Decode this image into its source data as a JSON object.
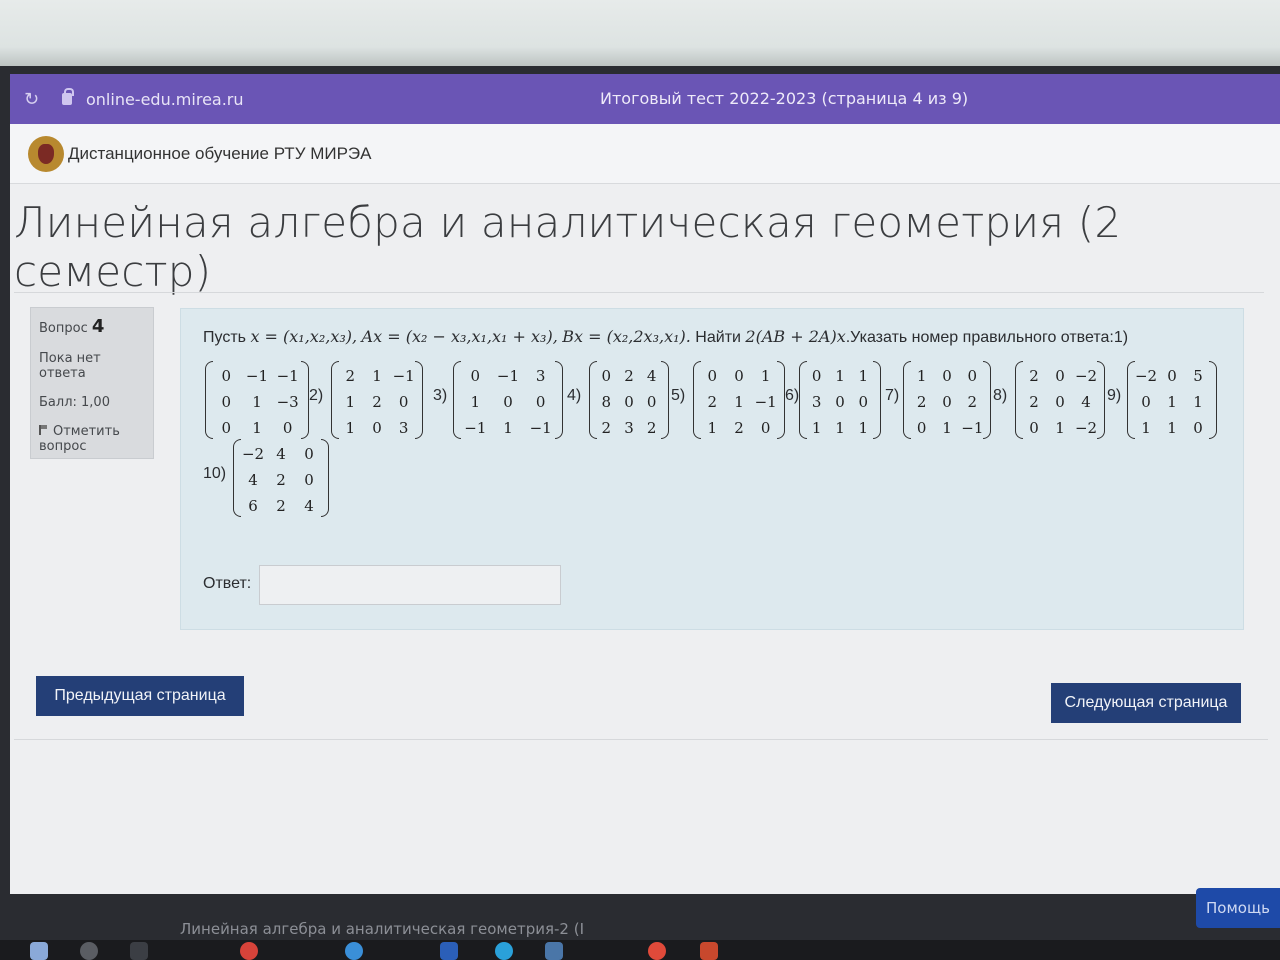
{
  "browser": {
    "url": "online-edu.mirea.ru",
    "tab_title": "Итоговый тест 2022-2023 (страница 4 из 9)"
  },
  "site": {
    "name": "Дистанционное обучение РТУ МИРЭА"
  },
  "course": {
    "title": "Линейная алгебра и аналитическая геометрия (2 семестр)"
  },
  "question_info": {
    "label": "Вопрос",
    "number": "4",
    "status": "Пока нет ответа",
    "score": "Балл: 1,00",
    "flag_label": "Отметить вопрос"
  },
  "question": {
    "intro": "Пусть",
    "x_def": "x = (x₁,x₂,x₃),",
    "a_def": "Ax = (x₂ − x₃,x₁,x₁ + x₃),",
    "b_def": "Bx = (x₂,2x₃,x₁).",
    "find": "Найти",
    "expr": "2(AB + 2A)x",
    "instruction": ".Указать номер правильного ответа:",
    "option_labels": [
      "1)",
      "2)",
      "3)",
      "4)",
      "5)",
      "6)",
      "7)",
      "8)",
      "9)",
      "10)"
    ],
    "matrices": [
      [
        [
          "0",
          "−1",
          "−1"
        ],
        [
          "0",
          "1",
          "−3"
        ],
        [
          "0",
          "1",
          "0"
        ]
      ],
      [
        [
          "2",
          "1",
          "−1"
        ],
        [
          "1",
          "2",
          "0"
        ],
        [
          "1",
          "0",
          "3"
        ]
      ],
      [
        [
          "0",
          "−1",
          "3"
        ],
        [
          "1",
          "0",
          "0"
        ],
        [
          "−1",
          "1",
          "−1"
        ]
      ],
      [
        [
          "0",
          "2",
          "4"
        ],
        [
          "8",
          "0",
          "0"
        ],
        [
          "2",
          "3",
          "2"
        ]
      ],
      [
        [
          "0",
          "0",
          "1"
        ],
        [
          "2",
          "1",
          "−1"
        ],
        [
          "1",
          "2",
          "0"
        ]
      ],
      [
        [
          "0",
          "1",
          "1"
        ],
        [
          "3",
          "0",
          "0"
        ],
        [
          "1",
          "1",
          "1"
        ]
      ],
      [
        [
          "1",
          "0",
          "0"
        ],
        [
          "2",
          "0",
          "2"
        ],
        [
          "0",
          "1",
          "−1"
        ]
      ],
      [
        [
          "2",
          "0",
          "−2"
        ],
        [
          "2",
          "0",
          "4"
        ],
        [
          "0",
          "1",
          "−2"
        ]
      ],
      [
        [
          "−2",
          "0",
          "5"
        ],
        [
          "0",
          "1",
          "1"
        ],
        [
          "1",
          "1",
          "0"
        ]
      ],
      [
        [
          "−2",
          "4",
          "0"
        ],
        [
          "4",
          "2",
          "0"
        ],
        [
          "6",
          "2",
          "4"
        ]
      ]
    ],
    "answer_label": "Ответ:",
    "answer_value": ""
  },
  "nav": {
    "prev_label": "Предыдущая страница",
    "next_label": "Следующая страница"
  },
  "help_label": "Помощь",
  "footer_text": "Линейная алгебра и аналитическая геометрия-2 (I"
}
